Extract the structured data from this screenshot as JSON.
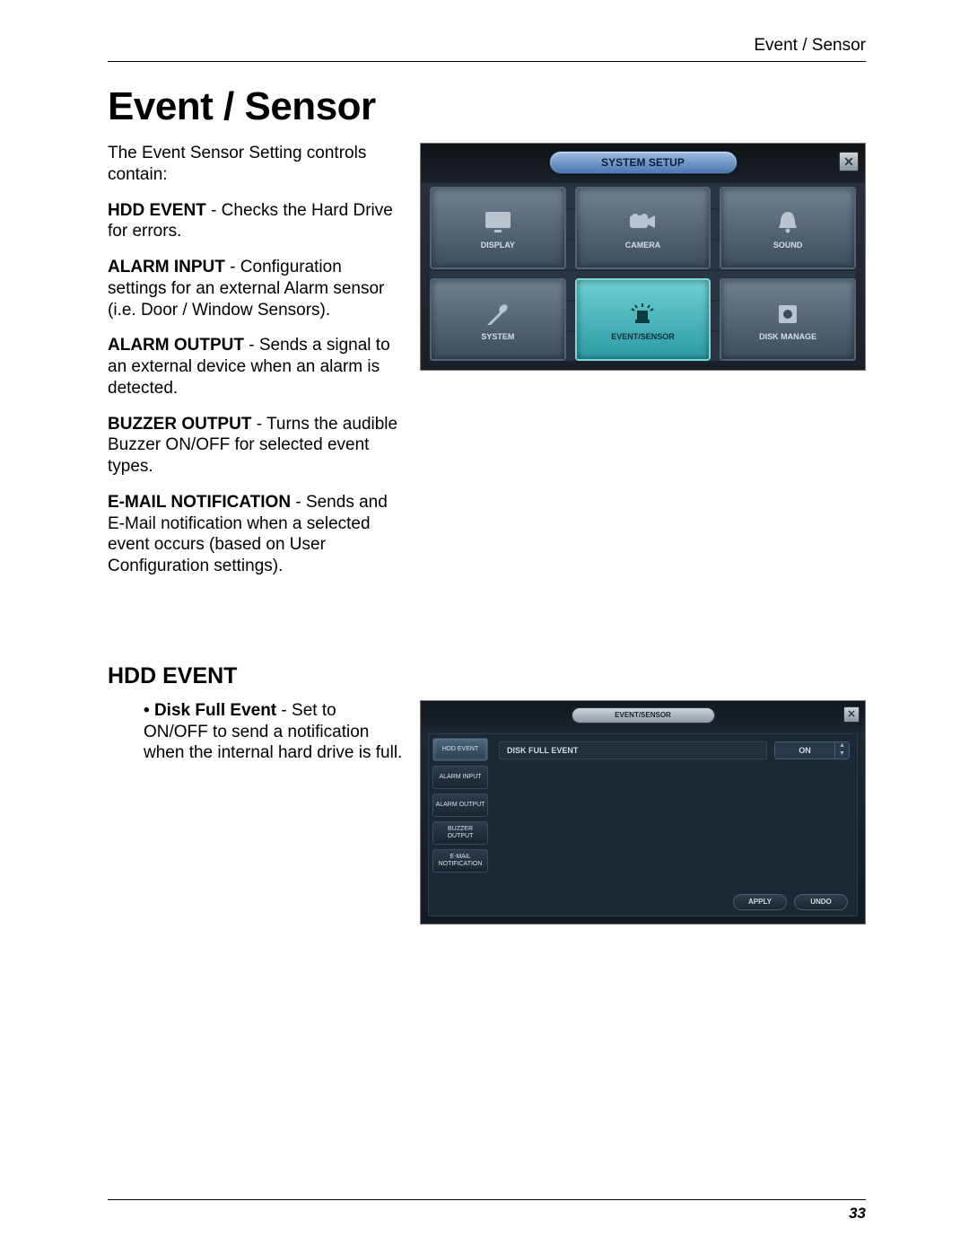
{
  "header": {
    "section_label": "Event / Sensor"
  },
  "title": "Event / Sensor",
  "intro": "The Event Sensor Setting controls contain:",
  "items": [
    {
      "term": "HDD EVENT",
      "desc": " - Checks the Hard Drive for errors."
    },
    {
      "term": "ALARM INPUT",
      "desc": " - Configuration settings for an external Alarm sensor (i.e. Door / Window Sensors)."
    },
    {
      "term": "ALARM OUTPUT",
      "desc": " - Sends a signal to an external device when an alarm is detected."
    },
    {
      "term": "BUZZER OUTPUT",
      "desc": " - Turns the audible Buzzer ON/OFF for selected event types."
    },
    {
      "term": "E-MAIL NOTIFICATION",
      "desc": " - Sends and E-Mail notification when a selected event occurs (based on User Configuration settings)."
    }
  ],
  "screenshot1": {
    "title": "SYSTEM SETUP",
    "close": "✕",
    "tiles": {
      "t0": "DISPLAY",
      "t1": "CAMERA",
      "t2": "SOUND",
      "t3": "SYSTEM",
      "t4": "EVENT/SENSOR",
      "t5": "DISK MANAGE"
    }
  },
  "section2": {
    "heading": "HDD EVENT",
    "bullet_term": "Disk Full Event",
    "bullet_desc": " - Set to ON/OFF to send a notification when the internal hard drive is full."
  },
  "screenshot2": {
    "title": "EVENT/SENSOR",
    "close": "✕",
    "tabs": {
      "t0": "HDD EVENT",
      "t1": "ALARM INPUT",
      "t2": "ALARM OUTPUT",
      "t3": "BUZZER OUTPUT",
      "t4": "E-MAIL NOTIFICATION"
    },
    "row_label": "DISK FULL EVENT",
    "row_value": "ON",
    "buttons": {
      "apply": "APPLY",
      "undo": "UNDO"
    }
  },
  "page_number": "33"
}
